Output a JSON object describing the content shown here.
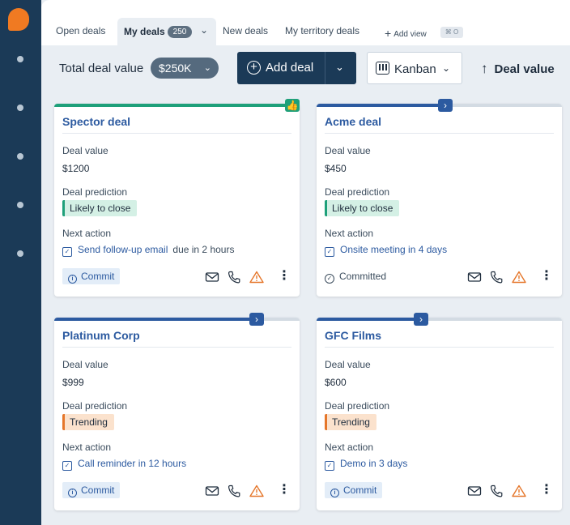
{
  "tabs": [
    {
      "label": "Open deals"
    },
    {
      "label": "My deals",
      "count": "250"
    },
    {
      "label": "New deals"
    },
    {
      "label": "My territory deals"
    }
  ],
  "add_view": {
    "label": "Add view",
    "shortcut": "⌘ O"
  },
  "toolbar": {
    "total_label": "Total deal value",
    "total_value": "$250K",
    "add_deal_label": "Add deal",
    "view_label": "Kanban",
    "sort_label": "Deal value"
  },
  "colors": {
    "green": "#1ea07a",
    "blue": "#2c5aa0",
    "orange": "#e5762a",
    "navy": "#1b3a57"
  },
  "cards": [
    {
      "title": "Spector deal",
      "value_label": "Deal value",
      "value": "$1200",
      "prediction_label": "Deal prediction",
      "prediction": "Likely to close",
      "next_label": "Next action",
      "next_action": "Send follow-up email",
      "due": "due in 2 hours",
      "commit": "Commit"
    },
    {
      "title": "Acme deal",
      "value_label": "Deal value",
      "value": "$450",
      "prediction_label": "Deal prediction",
      "prediction": "Likely to close",
      "next_label": "Next action",
      "next_action": "Onsite meeting in 4 days",
      "commit": "Committed"
    },
    {
      "title": "Platinum Corp",
      "value_label": "Deal value",
      "value": "$999",
      "prediction_label": "Deal prediction",
      "prediction": "Trending",
      "next_label": "Next action",
      "next_action": "Call reminder in 12 hours",
      "commit": "Commit"
    },
    {
      "title": "GFC Films",
      "value_label": "Deal value",
      "value": "$600",
      "prediction_label": "Deal prediction",
      "prediction": "Trending",
      "next_label": "Next action",
      "next_action": "Demo in 3 days",
      "commit": "Commit"
    }
  ]
}
